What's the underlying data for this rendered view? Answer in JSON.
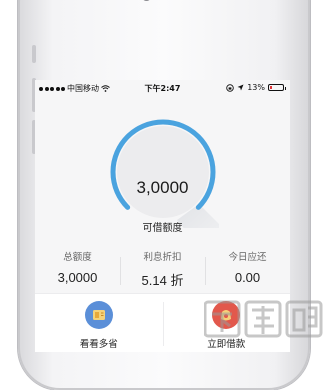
{
  "status_bar": {
    "carrier": "中国移动",
    "time": "下午2:47",
    "battery_percent": "13%",
    "signal_icon": "signal-dots-icon",
    "wifi_icon": "wifi-icon",
    "lock_icon": "rotation-lock-icon",
    "location_icon": "location-arrow-icon",
    "battery_icon": "battery-icon",
    "battery_level": 0.13
  },
  "gauge": {
    "value": "3,0000",
    "caption": "可借额度",
    "arc_color": "#4aa3df",
    "track_color": "#e4e6ea"
  },
  "stats": [
    {
      "label": "总额度",
      "value": "3,0000"
    },
    {
      "label": "利息折扣",
      "value": "5.14 折"
    },
    {
      "label": "今日应还",
      "value": "0.00"
    }
  ],
  "actions": [
    {
      "label": "看看多省",
      "icon": "coupon-icon",
      "color": "#5b8fd8"
    },
    {
      "label": "立即借款",
      "icon": "money-bag-icon",
      "color": "#e2584c"
    }
  ],
  "watermark_text": "下载吧"
}
